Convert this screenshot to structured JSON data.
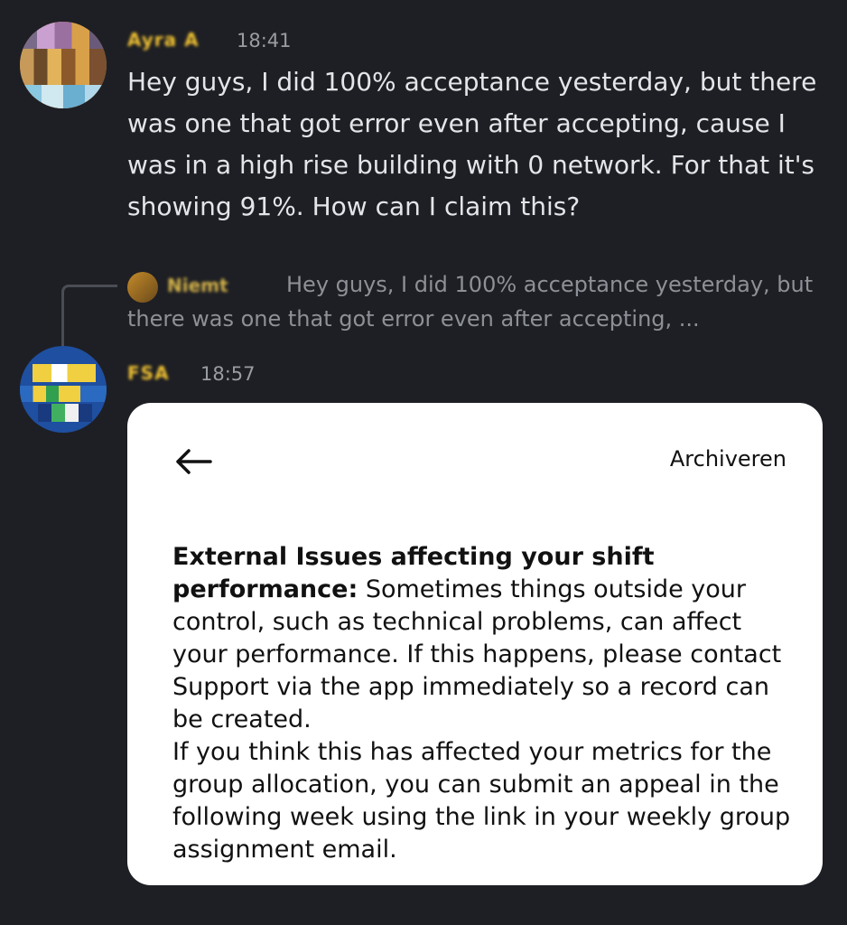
{
  "messages": [
    {
      "username": "Ayra A",
      "time": "18:41",
      "text": "Hey guys, I did 100% acceptance yesterday, but there was one that got error even after accepting, cause I was in a high rise building with 0 network. For that it's showing 91%. How can I claim this?"
    },
    {
      "username": "FSA",
      "time": "18:57"
    }
  ],
  "reply": {
    "username": "Niemt",
    "text": "Hey guys, I did 100% acceptance yesterday, but there was one that got error even after accepting, ..."
  },
  "card": {
    "archive_label": "Archiveren",
    "bold_text": "External Issues affecting your shift performance:",
    "text_part1": " Sometimes things outside your control, such as technical problems, can affect your performance. If this happens, please contact Support via the app immediately so a record can be created.",
    "text_part2": "If you think this has affected your metrics for the group allocation, you can submit an appeal in the following week using the link in your weekly group assignment email."
  },
  "colors": {
    "background": "#1e1f24",
    "username": "#f1c232",
    "card": "#ffffff"
  }
}
